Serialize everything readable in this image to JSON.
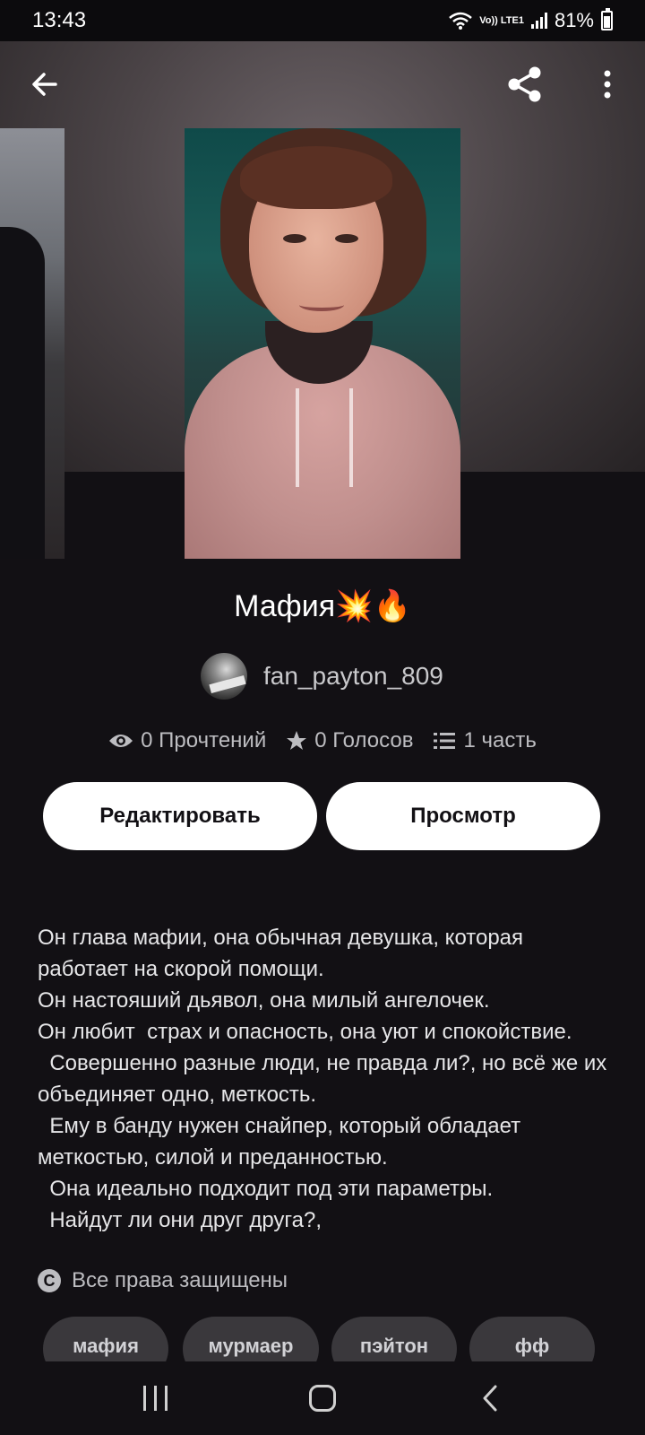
{
  "status_bar": {
    "time": "13:43",
    "network": "Vo)) LTE1",
    "battery": "81%"
  },
  "book": {
    "title": "Мафия💥🔥",
    "author": "fan_payton_809"
  },
  "stats": {
    "reads": "0 Прочтений",
    "votes": "0 Голосов",
    "parts": "1 часть"
  },
  "actions": {
    "edit_label": "Редактировать",
    "view_label": "Просмотр"
  },
  "description": "Он глава мафии, она обычная девушка, которая работает на скорой помощи.\nОн настояший дьявол, она милый ангелочек.\nОн любит  страх и опасность, она уют и спокойствие.\n  Совершенно разные люди, не правда ли?, но всё же их объединяет одно, меткость.\n  Ему в банду нужен снайпер, который обладает меткостью, силой и преданностью.\n  Она идеально подходит под эти параметры.\n  Найдут ли они друг друга?,",
  "rights": {
    "icon_text": "C",
    "label": "Все права защищены"
  },
  "tags": [
    "мафия",
    "мурмаер",
    "пэйтон",
    "фф"
  ],
  "icons": {
    "back": "arrow-left-icon",
    "share": "share-icon",
    "more": "more-vertical-icon",
    "reads": "eye-icon",
    "votes": "star-icon",
    "parts": "list-icon",
    "copyright": "copyright-icon"
  }
}
